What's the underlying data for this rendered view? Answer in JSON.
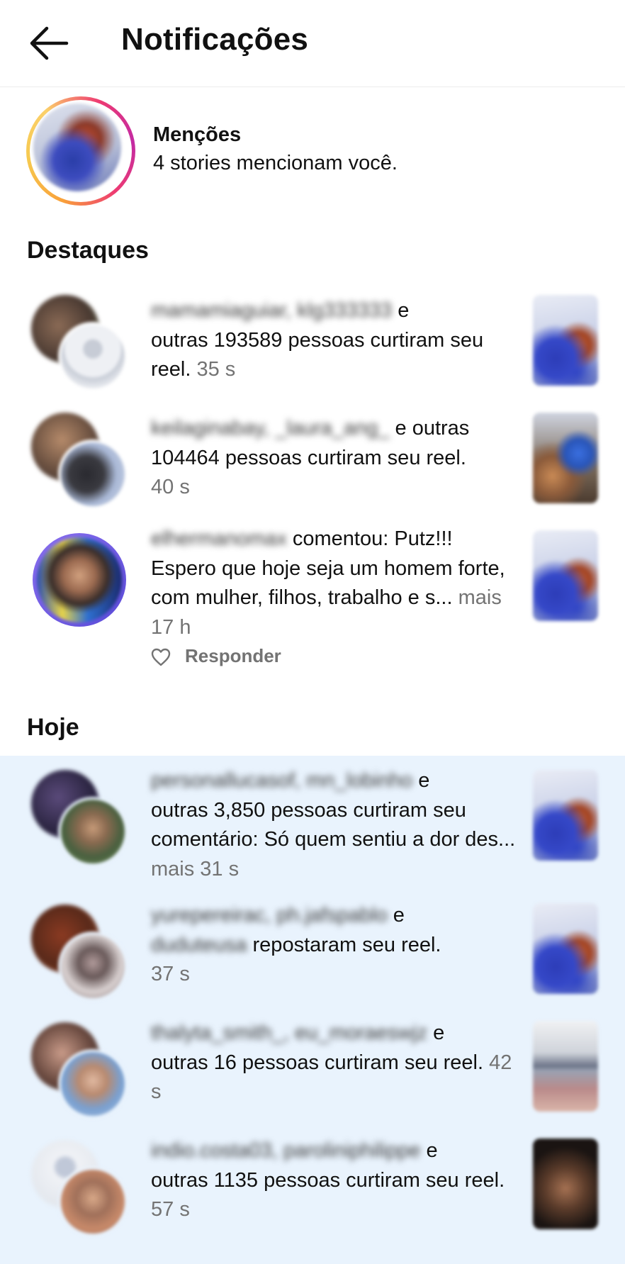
{
  "header": {
    "title": "Notificações"
  },
  "mentions": {
    "title": "Menções",
    "subtitle": "4 stories mencionam você."
  },
  "sections": {
    "highlights": "Destaques",
    "today": "Hoje"
  },
  "highlights": [
    {
      "names": "mamamiaguiar, klg333333",
      "text_line1_suffix": " e",
      "text": "outras 193589 pessoas curtiram seu reel.",
      "time": "35 s"
    },
    {
      "names": "keilaginabay, _laura_ang_",
      "text_line1_suffix": " e outras",
      "text": "104464 pessoas curtiram seu reel.",
      "time": "40 s"
    },
    {
      "names": "elhermanomax",
      "text_line1_suffix": " comentou: Putz!!!",
      "text": "Espero que hoje seja um homem forte, com mulher, filhos, trabalho e s...",
      "more": "mais",
      "time": "17 h",
      "reply_label": "Responder"
    }
  ],
  "today": [
    {
      "names": "personallucasof, mn_lobinho",
      "text_line1_suffix": " e",
      "text": "outras 3,850 pessoas curtiram seu comentário: Só quem sentiu a dor des...",
      "more": "mais",
      "time": "31 s"
    },
    {
      "names": "yurepereirac, ph.jafspablo",
      "text_line1_suffix": " e",
      "names2": "duduteusa",
      "text": " repostaram seu reel.",
      "time": "37 s"
    },
    {
      "names": "thalyta_smith_, eu_moraeswjz",
      "text_line1_suffix": " e",
      "text": "outras 16 pessoas curtiram seu reel.",
      "time": "42 s"
    },
    {
      "names": "indio.costa03, paroliniphilippe",
      "text_line1_suffix": " e",
      "text": "outras 1135 pessoas curtiram seu reel.",
      "time": "57 s"
    }
  ]
}
